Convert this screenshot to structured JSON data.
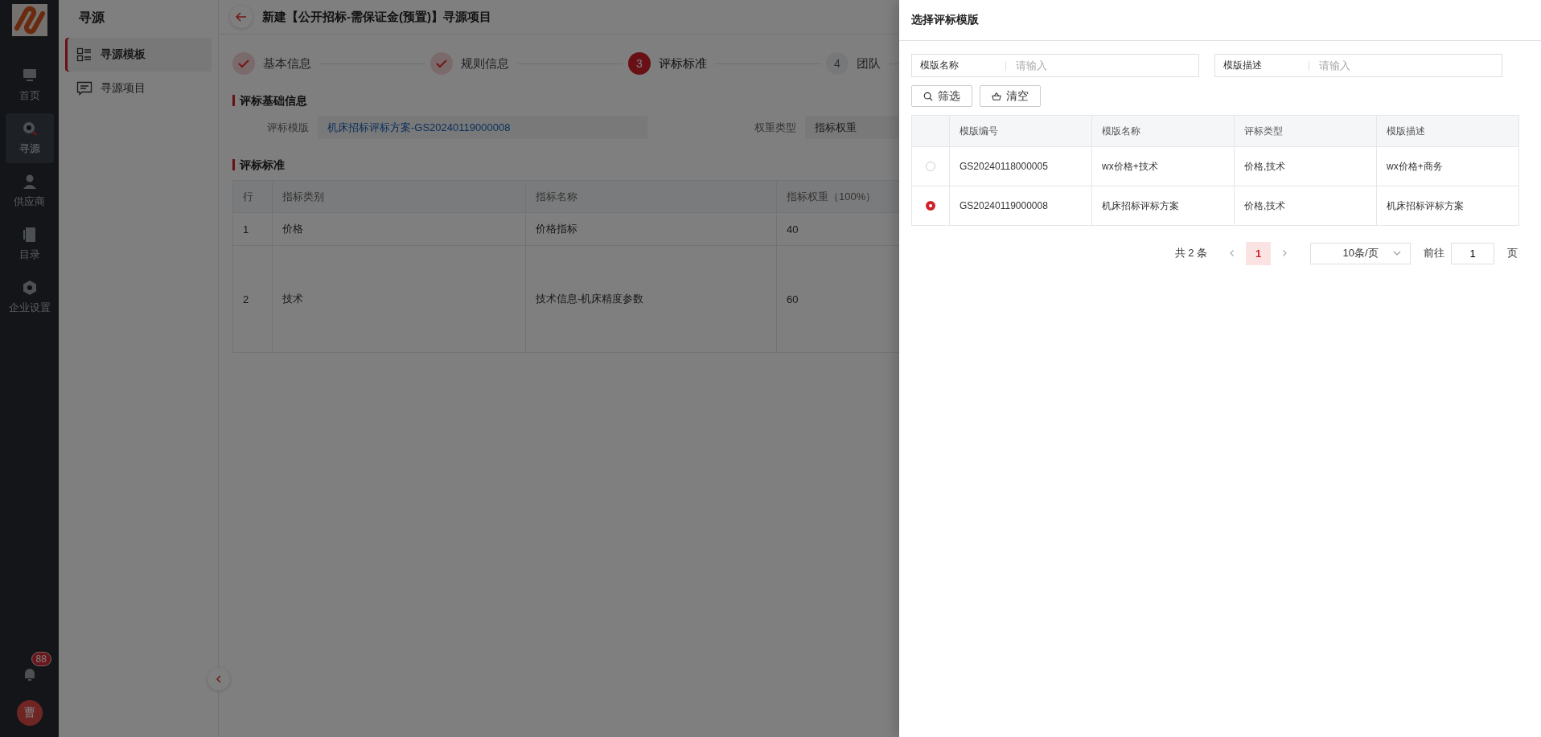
{
  "nav": {
    "items": [
      {
        "label": "首页",
        "selected": false
      },
      {
        "label": "寻源",
        "selected": true
      },
      {
        "label": "供应商",
        "selected": false
      },
      {
        "label": "目录",
        "selected": false
      },
      {
        "label": "企业设置",
        "selected": false
      }
    ],
    "badge": "88",
    "avatar": "曹"
  },
  "submenu": {
    "title": "寻源",
    "items": [
      {
        "label": "寻源模板",
        "selected": true
      },
      {
        "label": "寻源项目",
        "selected": false
      }
    ]
  },
  "page": {
    "title": "新建【公开招标-需保证金(预置)】寻源项目",
    "steps": [
      {
        "label": "基本信息",
        "completed": true,
        "selected": false
      },
      {
        "label": "规则信息",
        "completed": true,
        "selected": false
      },
      {
        "number": "3",
        "label": "评标标准",
        "completed": false,
        "selected": true
      },
      {
        "number": "4",
        "label": "团队",
        "completed": false,
        "selected": false
      }
    ],
    "basic_section": {
      "title": "评标基础信息",
      "fields": [
        {
          "label": "评标模版",
          "value": "机床招标评标方案-GS20240119000008",
          "kind": "link"
        },
        {
          "label": "权重类型",
          "value": "指标权重",
          "kind": "text"
        }
      ]
    },
    "criteria_section": {
      "title": "评标标准",
      "columns": [
        "行",
        "指标类别",
        "指标名称",
        "指标权重（100%）"
      ],
      "rows": [
        [
          "1",
          "价格",
          "价格指标",
          "40"
        ],
        [
          "2",
          "技术",
          "技术信息-机床精度参数",
          "60"
        ]
      ]
    }
  },
  "drawer": {
    "title": "选择评标模版",
    "filters": [
      {
        "label": "模版名称",
        "placeholder": "请输入"
      },
      {
        "label": "模版描述",
        "placeholder": "请输入"
      }
    ],
    "buttons": [
      {
        "label": "筛选",
        "kind": "search"
      },
      {
        "label": "清空",
        "kind": "clear"
      }
    ],
    "table": {
      "columns": [
        "模版编号",
        "模版名称",
        "评标类型",
        "模版描述"
      ],
      "rows": [
        {
          "selected": false,
          "cells": [
            "GS20240118000005",
            "wx价格+技术",
            "价格,技术",
            "wx价格+商务"
          ]
        },
        {
          "selected": true,
          "cells": [
            "GS20240119000008",
            "机床招标评标方案",
            "价格,技术",
            "机床招标评标方案"
          ]
        }
      ]
    },
    "pagination": {
      "total": "共 2 条",
      "pages": [
        {
          "label": "1",
          "selected": true
        }
      ],
      "page_size": "10条/页",
      "goto_label": "前往",
      "goto_value": "1",
      "goto_suffix": "页"
    }
  }
}
